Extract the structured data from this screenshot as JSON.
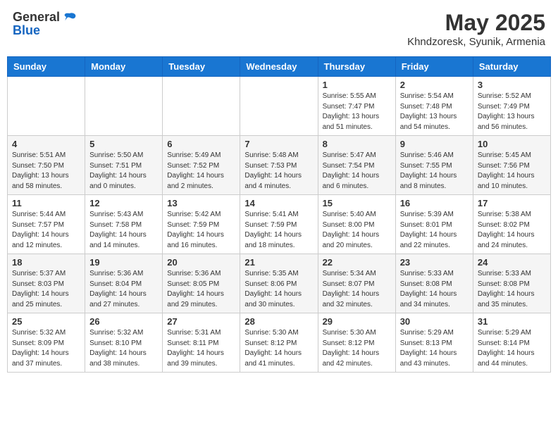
{
  "header": {
    "logo_general": "General",
    "logo_blue": "Blue",
    "month_title": "May 2025",
    "location": "Khndzoresk, Syunik, Armenia"
  },
  "weekdays": [
    "Sunday",
    "Monday",
    "Tuesday",
    "Wednesday",
    "Thursday",
    "Friday",
    "Saturday"
  ],
  "weeks": [
    [
      {
        "day": "",
        "info": ""
      },
      {
        "day": "",
        "info": ""
      },
      {
        "day": "",
        "info": ""
      },
      {
        "day": "",
        "info": ""
      },
      {
        "day": "1",
        "info": "Sunrise: 5:55 AM\nSunset: 7:47 PM\nDaylight: 13 hours\nand 51 minutes."
      },
      {
        "day": "2",
        "info": "Sunrise: 5:54 AM\nSunset: 7:48 PM\nDaylight: 13 hours\nand 54 minutes."
      },
      {
        "day": "3",
        "info": "Sunrise: 5:52 AM\nSunset: 7:49 PM\nDaylight: 13 hours\nand 56 minutes."
      }
    ],
    [
      {
        "day": "4",
        "info": "Sunrise: 5:51 AM\nSunset: 7:50 PM\nDaylight: 13 hours\nand 58 minutes."
      },
      {
        "day": "5",
        "info": "Sunrise: 5:50 AM\nSunset: 7:51 PM\nDaylight: 14 hours\nand 0 minutes."
      },
      {
        "day": "6",
        "info": "Sunrise: 5:49 AM\nSunset: 7:52 PM\nDaylight: 14 hours\nand 2 minutes."
      },
      {
        "day": "7",
        "info": "Sunrise: 5:48 AM\nSunset: 7:53 PM\nDaylight: 14 hours\nand 4 minutes."
      },
      {
        "day": "8",
        "info": "Sunrise: 5:47 AM\nSunset: 7:54 PM\nDaylight: 14 hours\nand 6 minutes."
      },
      {
        "day": "9",
        "info": "Sunrise: 5:46 AM\nSunset: 7:55 PM\nDaylight: 14 hours\nand 8 minutes."
      },
      {
        "day": "10",
        "info": "Sunrise: 5:45 AM\nSunset: 7:56 PM\nDaylight: 14 hours\nand 10 minutes."
      }
    ],
    [
      {
        "day": "11",
        "info": "Sunrise: 5:44 AM\nSunset: 7:57 PM\nDaylight: 14 hours\nand 12 minutes."
      },
      {
        "day": "12",
        "info": "Sunrise: 5:43 AM\nSunset: 7:58 PM\nDaylight: 14 hours\nand 14 minutes."
      },
      {
        "day": "13",
        "info": "Sunrise: 5:42 AM\nSunset: 7:59 PM\nDaylight: 14 hours\nand 16 minutes."
      },
      {
        "day": "14",
        "info": "Sunrise: 5:41 AM\nSunset: 7:59 PM\nDaylight: 14 hours\nand 18 minutes."
      },
      {
        "day": "15",
        "info": "Sunrise: 5:40 AM\nSunset: 8:00 PM\nDaylight: 14 hours\nand 20 minutes."
      },
      {
        "day": "16",
        "info": "Sunrise: 5:39 AM\nSunset: 8:01 PM\nDaylight: 14 hours\nand 22 minutes."
      },
      {
        "day": "17",
        "info": "Sunrise: 5:38 AM\nSunset: 8:02 PM\nDaylight: 14 hours\nand 24 minutes."
      }
    ],
    [
      {
        "day": "18",
        "info": "Sunrise: 5:37 AM\nSunset: 8:03 PM\nDaylight: 14 hours\nand 25 minutes."
      },
      {
        "day": "19",
        "info": "Sunrise: 5:36 AM\nSunset: 8:04 PM\nDaylight: 14 hours\nand 27 minutes."
      },
      {
        "day": "20",
        "info": "Sunrise: 5:36 AM\nSunset: 8:05 PM\nDaylight: 14 hours\nand 29 minutes."
      },
      {
        "day": "21",
        "info": "Sunrise: 5:35 AM\nSunset: 8:06 PM\nDaylight: 14 hours\nand 30 minutes."
      },
      {
        "day": "22",
        "info": "Sunrise: 5:34 AM\nSunset: 8:07 PM\nDaylight: 14 hours\nand 32 minutes."
      },
      {
        "day": "23",
        "info": "Sunrise: 5:33 AM\nSunset: 8:08 PM\nDaylight: 14 hours\nand 34 minutes."
      },
      {
        "day": "24",
        "info": "Sunrise: 5:33 AM\nSunset: 8:08 PM\nDaylight: 14 hours\nand 35 minutes."
      }
    ],
    [
      {
        "day": "25",
        "info": "Sunrise: 5:32 AM\nSunset: 8:09 PM\nDaylight: 14 hours\nand 37 minutes."
      },
      {
        "day": "26",
        "info": "Sunrise: 5:32 AM\nSunset: 8:10 PM\nDaylight: 14 hours\nand 38 minutes."
      },
      {
        "day": "27",
        "info": "Sunrise: 5:31 AM\nSunset: 8:11 PM\nDaylight: 14 hours\nand 39 minutes."
      },
      {
        "day": "28",
        "info": "Sunrise: 5:30 AM\nSunset: 8:12 PM\nDaylight: 14 hours\nand 41 minutes."
      },
      {
        "day": "29",
        "info": "Sunrise: 5:30 AM\nSunset: 8:12 PM\nDaylight: 14 hours\nand 42 minutes."
      },
      {
        "day": "30",
        "info": "Sunrise: 5:29 AM\nSunset: 8:13 PM\nDaylight: 14 hours\nand 43 minutes."
      },
      {
        "day": "31",
        "info": "Sunrise: 5:29 AM\nSunset: 8:14 PM\nDaylight: 14 hours\nand 44 minutes."
      }
    ]
  ]
}
